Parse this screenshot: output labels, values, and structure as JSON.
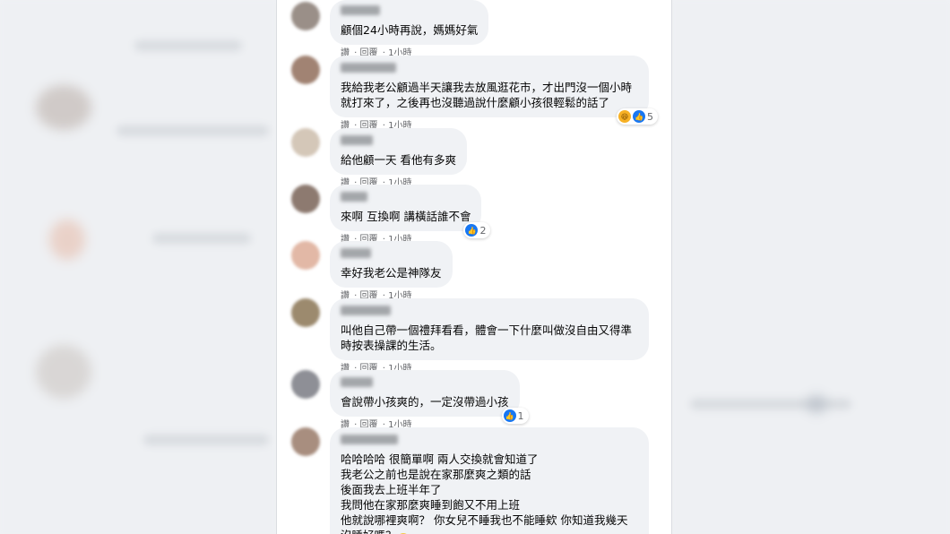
{
  "colors": {
    "like": "#1877f2",
    "bubble": "#f0f2f5",
    "meta": "#65676b"
  },
  "comments": [
    {
      "text": "顧個24小時再說，媽媽好氣",
      "actions": [
        "讚",
        "回覆",
        "1小時"
      ]
    },
    {
      "text": "我給我老公顧過半天讓我去放風逛花市，才出門沒一個小時就打來了，之後再也沒聽過說什麼顧小孩很輕鬆的話了",
      "actions": [
        "讚",
        "回覆",
        "1小時"
      ],
      "reaction_count": "5"
    },
    {
      "text": "給他顧一天 看他有多爽",
      "actions": [
        "讚",
        "回覆",
        "1小時"
      ]
    },
    {
      "text": "來啊 互換啊 講橫話誰不會",
      "actions": [
        "讚",
        "回覆",
        "1小時"
      ],
      "reaction_count": "2"
    },
    {
      "text": "幸好我老公是神隊友",
      "actions": [
        "讚",
        "回覆",
        "1小時"
      ]
    },
    {
      "text": "叫他自己帶一個禮拜看看，體會一下什麼叫做沒自由又得準時按表操課的生活。",
      "actions": [
        "讚",
        "回覆",
        "1小時"
      ]
    },
    {
      "text": "會說帶小孩爽的，一定沒帶過小孩",
      "actions": [
        "讚",
        "回覆",
        "1小時"
      ],
      "reaction_count": "1"
    },
    {
      "text": "哈哈哈哈 很簡單啊 兩人交換就會知道了\n我老公之前也是說在家那麼爽之類的話\n後面我去上班半年了\n我問他在家那麼爽睡到飽又不用上班\n他就說哪裡爽啊？ 你女兒不睡我也不能睡欸 你知道我幾天沒睡好嗎？"
    }
  ]
}
